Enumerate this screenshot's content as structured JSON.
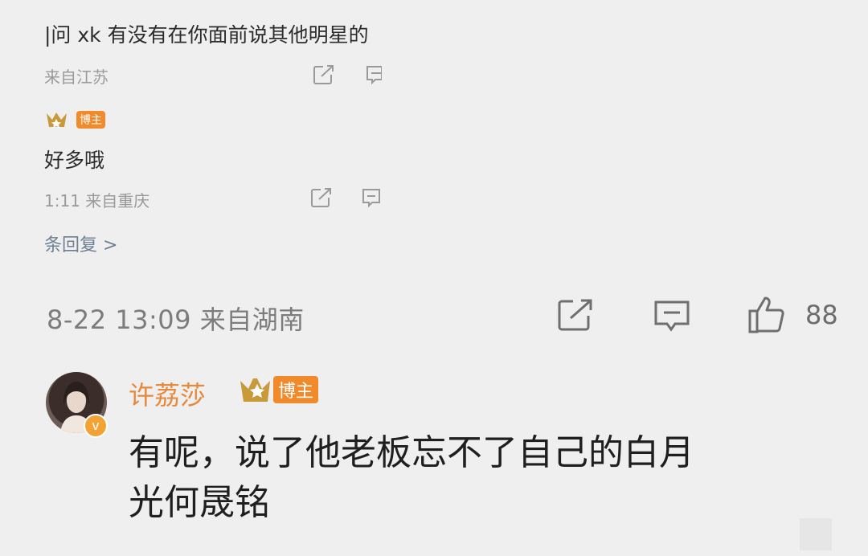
{
  "reply_block": {
    "first_reply": {
      "text": "|问 xk 有没有在你面前说其他明星的",
      "meta": "来自江苏"
    },
    "second_reply": {
      "badge_label": "博主",
      "text": "好多哦",
      "meta": "1:11 来自重庆"
    },
    "more_replies_label": "条回复 >"
  },
  "main_comment_meta": {
    "datetime_location": "8-22 13:09 来自湖南",
    "like_count": "88"
  },
  "comment": {
    "username": "许荔莎",
    "badge_label": "博主",
    "verified_mark": "v",
    "text_line1": "有呢，说了他老板忘不了自己的白月",
    "text_line2": "光何晟铭"
  },
  "colors": {
    "background": "#efefef",
    "username": "#e8883a",
    "badge": "#f08a2a",
    "link": "#6f7f92"
  }
}
